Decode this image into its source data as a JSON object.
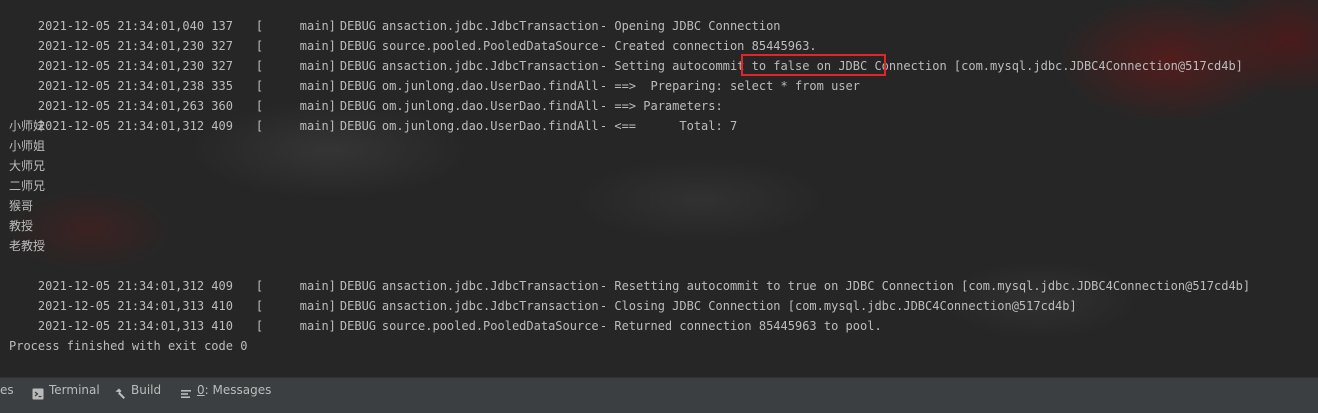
{
  "console": {
    "log_lines": [
      {
        "time": "2021-12-05 21:34:01,040 137",
        "thread": "main]",
        "level": "DEBUG",
        "logger": "ansaction.jdbc.JdbcTransaction",
        "message": "- Opening JDBC Connection"
      },
      {
        "time": "2021-12-05 21:34:01,230 327",
        "thread": "main]",
        "level": "DEBUG",
        "logger": "source.pooled.PooledDataSource",
        "message": "- Created connection 85445963."
      },
      {
        "time": "2021-12-05 21:34:01,230 327",
        "thread": "main]",
        "level": "DEBUG",
        "logger": "ansaction.jdbc.JdbcTransaction",
        "message": "- Setting autocommit to false on JDBC Connection [com.mysql.jdbc.JDBC4Connection@517cd4b]"
      },
      {
        "time": "2021-12-05 21:34:01,238 335",
        "thread": "main]",
        "level": "DEBUG",
        "logger": "om.junlong.dao.UserDao.findAll",
        "message": "- ==>  Preparing: select * from user"
      },
      {
        "time": "2021-12-05 21:34:01,263 360",
        "thread": "main]",
        "level": "DEBUG",
        "logger": "om.junlong.dao.UserDao.findAll",
        "message": "- ==> Parameters: "
      },
      {
        "time": "2021-12-05 21:34:01,312 409",
        "thread": "main]",
        "level": "DEBUG",
        "logger": "om.junlong.dao.UserDao.findAll",
        "message": "- <==      Total: 7"
      }
    ],
    "names": [
      "小师妹",
      "小师姐",
      "大师兄",
      "二师兄",
      "猴哥",
      "教授",
      "老教授"
    ],
    "tail_lines": [
      {
        "time": "2021-12-05 21:34:01,312 409",
        "thread": "main]",
        "level": "DEBUG",
        "logger": "ansaction.jdbc.JdbcTransaction",
        "message": "- Resetting autocommit to true on JDBC Connection [com.mysql.jdbc.JDBC4Connection@517cd4b]"
      },
      {
        "time": "2021-12-05 21:34:01,313 410",
        "thread": "main]",
        "level": "DEBUG",
        "logger": "ansaction.jdbc.JdbcTransaction",
        "message": "- Closing JDBC Connection [com.mysql.jdbc.JDBC4Connection@517cd4b]"
      },
      {
        "time": "2021-12-05 21:34:01,313 410",
        "thread": "main]",
        "level": "DEBUG",
        "logger": "source.pooled.PooledDataSource",
        "message": "- Returned connection 85445963 to pool."
      }
    ],
    "exit_message": "Process finished with exit code 0",
    "highlight_color": "#e0262b"
  },
  "toolbar": {
    "partial_label": "es",
    "terminal_label": "Terminal",
    "build_label": "Build",
    "messages_prefix": "0",
    "messages_label": ": Messages"
  },
  "icons": {
    "terminal": "terminal-icon",
    "build": "hammer-icon",
    "messages": "messages-icon"
  }
}
